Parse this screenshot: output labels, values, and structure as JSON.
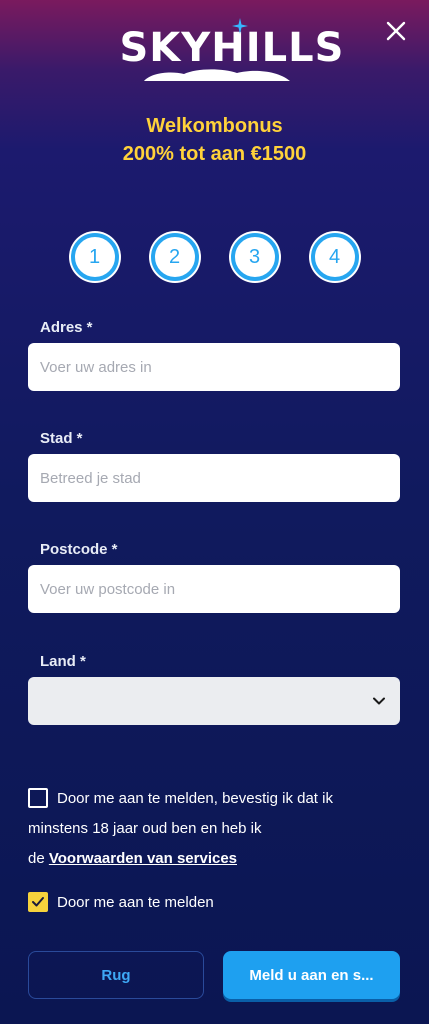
{
  "brand": {
    "logo_text": "SKYHILLS"
  },
  "bonus": {
    "line1": "Welkombonus",
    "line2": "200% tot aan €1500"
  },
  "steps": [
    {
      "label": "1"
    },
    {
      "label": "2"
    },
    {
      "label": "3"
    },
    {
      "label": "4"
    }
  ],
  "form": {
    "address": {
      "label": "Adres *",
      "placeholder": "Voer uw adres in",
      "value": ""
    },
    "city": {
      "label": "Stad *",
      "placeholder": "Betreed je stad",
      "value": ""
    },
    "postcode": {
      "label": "Postcode *",
      "placeholder": "Voer uw postcode in",
      "value": ""
    },
    "country": {
      "label": "Land *",
      "selected": ""
    }
  },
  "terms": {
    "line1": "Door me aan te melden, bevestig ik dat ik",
    "line2": "minstens 18 jaar oud ben en heb ik",
    "line3_prefix": "de ",
    "link_text": "Voorwaarden van services",
    "checked": false
  },
  "consent": {
    "label": "Door me aan te melden",
    "checked": true
  },
  "buttons": {
    "back": "Rug",
    "submit": "Meld u aan en s..."
  },
  "colors": {
    "accent_yellow": "#ffd23a",
    "accent_blue": "#27a6f0",
    "submit_blue": "#1ea0f0"
  }
}
